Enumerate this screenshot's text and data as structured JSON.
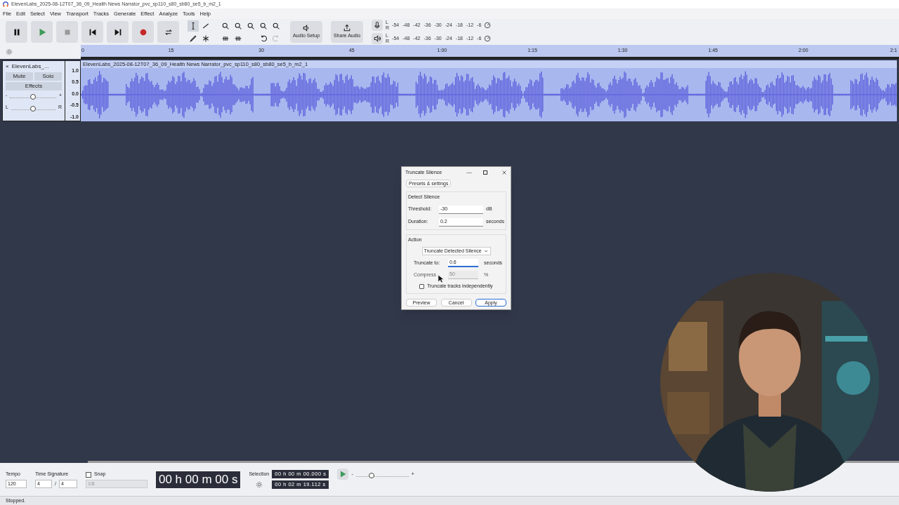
{
  "window": {
    "title": "ElevenLabs_2025-08-12T07_36_09_Health News Narrator_pvc_sp110_s80_sb80_se5_b_m2_1"
  },
  "menu": [
    "File",
    "Edit",
    "Select",
    "View",
    "Transport",
    "Tracks",
    "Generate",
    "Effect",
    "Analyze",
    "Tools",
    "Help"
  ],
  "toolbar": {
    "audio_setup": "Audio Setup",
    "share_audio": "Share Audio",
    "meters": [
      {
        "kind": "record",
        "channels": [
          "L",
          "R"
        ],
        "scale": [
          "-54",
          "-48",
          "-42",
          "-36",
          "-30",
          "-24",
          "-18",
          "-12",
          "-6"
        ]
      },
      {
        "kind": "playback",
        "channels": [
          "L",
          "R"
        ],
        "scale": [
          "-54",
          "-48",
          "-42",
          "-36",
          "-30",
          "-24",
          "-18",
          "-12",
          "-6"
        ]
      }
    ]
  },
  "ruler": {
    "ticks": [
      "0",
      "15",
      "30",
      "45",
      "1:00",
      "1:15",
      "1:30",
      "1:45",
      "2:00",
      "2:1"
    ]
  },
  "track": {
    "close": "×",
    "name": "ElevenLabs_...",
    "mute": "Mute",
    "solo": "Solo",
    "effects": "Effects",
    "gain": {
      "minus": "-",
      "plus": "+",
      "level": 0.5
    },
    "pan": {
      "left": "L",
      "right": "R",
      "level": 0.5
    },
    "scale": [
      "1.0",
      "0.5",
      "0.0",
      "-0.5",
      "-1.0"
    ],
    "clip_title": "ElevenLabs_2025-08-12T07_36_09_Health News Narrator_pvc_sp110_s80_sb80_se5_b_m2_1"
  },
  "dialog": {
    "title": "Truncate Silence",
    "presets": "Presets & settings",
    "detect_group": "Detect Silence",
    "detect_fields": [
      {
        "label": "Threshold:",
        "value": "-30",
        "unit": "dB"
      },
      {
        "label": "Duration:",
        "value": "0.2",
        "unit": "seconds"
      }
    ],
    "action_group": "Action",
    "action": "Truncate Detected Silence",
    "action_fields": [
      {
        "label": "Truncate to:",
        "value": "0.6",
        "unit": "seconds",
        "disabled": false,
        "focused": true
      },
      {
        "label": "Compress",
        "value": "50",
        "unit": "%",
        "disabled": true,
        "focused": false
      }
    ],
    "independent": {
      "label": "Truncate tracks independently",
      "checked": false
    },
    "buttons": [
      {
        "label": "Preview",
        "default": false
      },
      {
        "label": "Cancel",
        "default": false
      },
      {
        "label": "Apply",
        "default": true
      }
    ]
  },
  "bottom": {
    "tempo_label": "Tempo",
    "tempo": "120",
    "time_signature_label": "Time Signature",
    "ts_upper": "4",
    "ts_slash": "/",
    "ts_lower": "4",
    "snap": {
      "label": "Snap",
      "checked": false,
      "value": "1/8"
    },
    "time": "00 h 00 m 00 s",
    "selection_label": "Selection",
    "selection": [
      "00 h 00 m 00.000 s",
      "00 h 02 m 19.112 s"
    ],
    "play_speed": {
      "minus": "-",
      "plus": "+",
      "level": 0.3
    }
  },
  "status": "Stopped."
}
